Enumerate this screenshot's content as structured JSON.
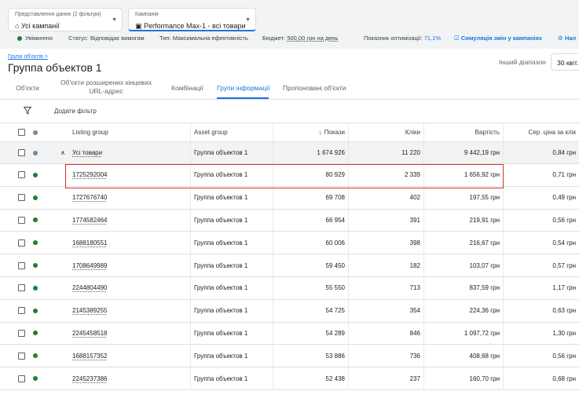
{
  "top": {
    "view": {
      "label": "Представлення даних (2 фільтри)",
      "value": "Усі кампанії",
      "icon": "home-icon"
    },
    "campaign": {
      "label": "Кампанія",
      "value": "Performance Max-1 - всі товари",
      "icon": "campaign-icon"
    },
    "status": {
      "enabled": "Увімкнено",
      "state": "Статус: Відповідає вимогам",
      "type_label": "Тип:",
      "type_value": "Максимальна ефективність",
      "budget_label": "Бюджет:",
      "budget_value": "500,00 грн на день",
      "score_label": "Показник оптимізації:",
      "score_value": "71,1%",
      "simulate": "Симуляція змін у кампаніях",
      "settings": "Нал"
    }
  },
  "page": {
    "breadcrumb": "Групи об'єктів >",
    "title": "Группа объектов 1",
    "range_label": "Інший діапазон",
    "range_value": "30 квіт."
  },
  "tabs": [
    {
      "label": "Об'єкти"
    },
    {
      "label": "Об'єкти розширених кінцевих URL-адрес"
    },
    {
      "label": "Комбінації"
    },
    {
      "label": "Групи інформації"
    },
    {
      "label": "Пропоновані об'єкти"
    }
  ],
  "filter": {
    "label": "Додати фільтр"
  },
  "table": {
    "headers": {
      "listing": "Listing group",
      "asset": "Asset group",
      "impressions": "Покази",
      "clicks": "Кліки",
      "cost": "Вартість",
      "cpc": "Сер. ціна за клік"
    },
    "group_row": {
      "name": "Усі товари",
      "asset": "Группа объектов 1",
      "impressions": "1 674 926",
      "clicks": "11 220",
      "cost": "9 442,19 грн",
      "cpc": "0,84 грн"
    },
    "rows": [
      {
        "name": "1725292004",
        "asset": "Группа объектов 1",
        "impressions": "80 929",
        "clicks": "2 339",
        "cost": "1 656,92 грн",
        "cpc": "0,71 грн"
      },
      {
        "name": "1727676740",
        "asset": "Группа объектов 1",
        "impressions": "69 708",
        "clicks": "402",
        "cost": "197,55 грн",
        "cpc": "0,49 грн"
      },
      {
        "name": "1774582464",
        "asset": "Группа объектов 1",
        "impressions": "66 954",
        "clicks": "391",
        "cost": "219,91 грн",
        "cpc": "0,56 грн"
      },
      {
        "name": "1688180551",
        "asset": "Группа объектов 1",
        "impressions": "60 006",
        "clicks": "398",
        "cost": "216,67 грн",
        "cpc": "0,54 грн"
      },
      {
        "name": "1708649989",
        "asset": "Группа объектов 1",
        "impressions": "59 450",
        "clicks": "182",
        "cost": "103,07 грн",
        "cpc": "0,57 грн"
      },
      {
        "name": "2244804490",
        "asset": "Группа объектов 1",
        "impressions": "55 550",
        "clicks": "713",
        "cost": "837,59 грн",
        "cpc": "1,17 грн"
      },
      {
        "name": "2145389255",
        "asset": "Группа объектов 1",
        "impressions": "54 725",
        "clicks": "354",
        "cost": "224,36 грн",
        "cpc": "0,63 грн"
      },
      {
        "name": "2245458518",
        "asset": "Группа объектов 1",
        "impressions": "54 289",
        "clicks": "846",
        "cost": "1 097,72 грн",
        "cpc": "1,30 грн"
      },
      {
        "name": "1688157352",
        "asset": "Группа объектов 1",
        "impressions": "53 886",
        "clicks": "736",
        "cost": "408,68 грн",
        "cpc": "0,56 грн"
      },
      {
        "name": "2245237386",
        "asset": "Группа объектов 1",
        "impressions": "52 438",
        "clicks": "237",
        "cost": "160,70 грн",
        "cpc": "0,68 грн"
      }
    ]
  },
  "colors": {
    "accent": "#1a73e8",
    "enabled": "#188038",
    "highlight": "#d93025"
  }
}
